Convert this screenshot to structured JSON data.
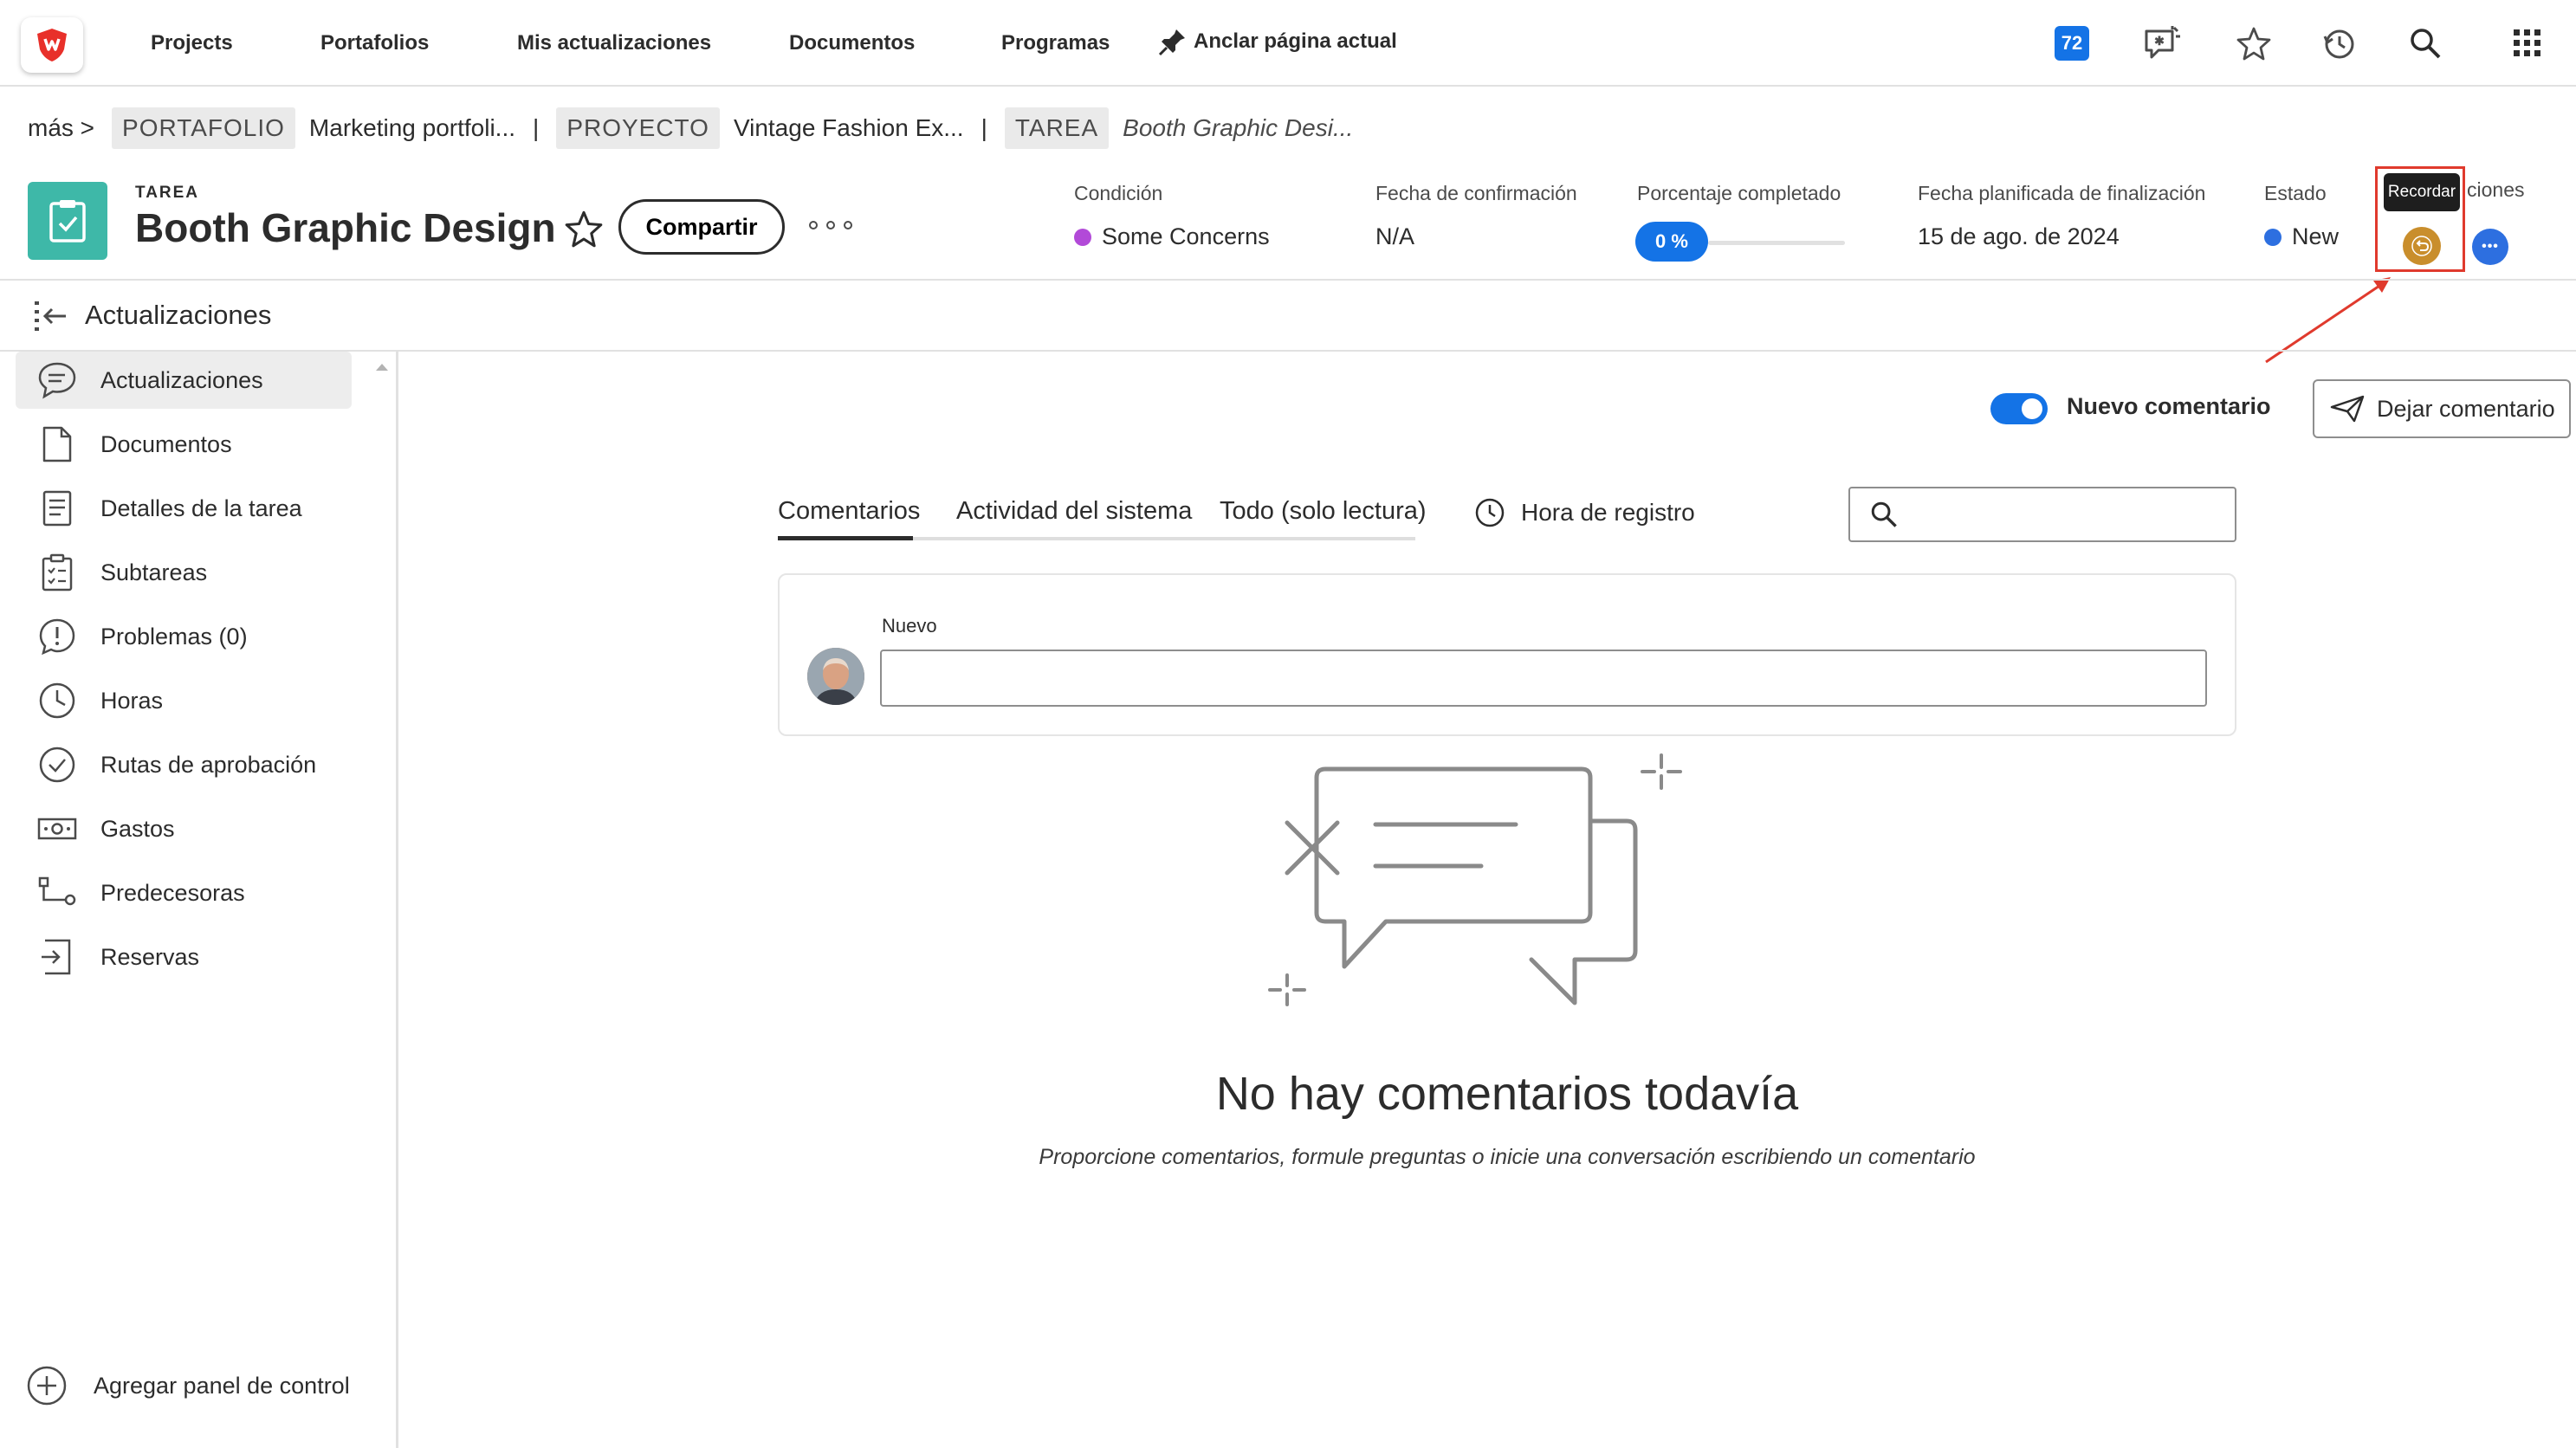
{
  "topnav": {
    "items": [
      "Projects",
      "Portafolios",
      "Mis actualizaciones",
      "Documentos",
      "Programas"
    ],
    "pin_label": "Anclar página actual",
    "notifications_count": "72"
  },
  "breadcrumb": {
    "more": "más >",
    "portfolio_tag": "PORTAFOLIO",
    "portfolio_name": "Marketing portfoli...",
    "project_tag": "PROYECTO",
    "project_name": "Vintage Fashion Ex...",
    "task_tag": "TAREA",
    "task_name": "Booth Graphic Desi...",
    "separator": "|"
  },
  "header": {
    "object_type": "TAREA",
    "title": "Booth Graphic Design",
    "share_label": "Compartir",
    "fields": {
      "condition_label": "Condición",
      "condition_value": "Some Concerns",
      "condition_color": "#b24ad8",
      "commit_date_label": "Fecha de confirmación",
      "commit_date_value": "N/A",
      "percent_label": "Porcentaje completado",
      "percent_value": "0 %",
      "percent_complete": 0,
      "planned_completion_label": "Fecha planificada de finalización",
      "planned_completion_value": "15 de ago. de 2024",
      "status_label": "Estado",
      "status_value": "New",
      "status_color": "#2d6fe0",
      "actions_label": "ciones"
    },
    "tooltip": "Recordar"
  },
  "panel": {
    "title": "Actualizaciones"
  },
  "sidebar": {
    "items": [
      {
        "label": "Actualizaciones",
        "icon": "chat-bubble-icon"
      },
      {
        "label": "Documentos",
        "icon": "document-icon"
      },
      {
        "label": "Detalles de la tarea",
        "icon": "details-icon"
      },
      {
        "label": "Subtareas",
        "icon": "subtasks-icon"
      },
      {
        "label": "Problemas (0)",
        "icon": "issue-icon"
      },
      {
        "label": "Horas",
        "icon": "clock-icon"
      },
      {
        "label": "Rutas de aprobación",
        "icon": "checkmark-circle-icon"
      },
      {
        "label": "Gastos",
        "icon": "money-icon"
      },
      {
        "label": "Predecesoras",
        "icon": "predecessor-icon"
      },
      {
        "label": "Reservas",
        "icon": "reservation-icon"
      }
    ],
    "add_dashboard": "Agregar panel de control"
  },
  "main": {
    "toggle_label": "Nuevo comentario",
    "toggle_on": true,
    "leave_comment_label": "Dejar comentario",
    "tabs": [
      "Comentarios",
      "Actividad del sistema",
      "Todo (solo lectura)"
    ],
    "active_tab": "Comentarios",
    "hora_registro": "Hora de registro",
    "new_comment_label": "Nuevo",
    "empty_title": "No hay comentarios todavía",
    "empty_subtitle": "Proporcione comentarios, formule preguntas o inicie una conversación escribiendo un comentario"
  }
}
